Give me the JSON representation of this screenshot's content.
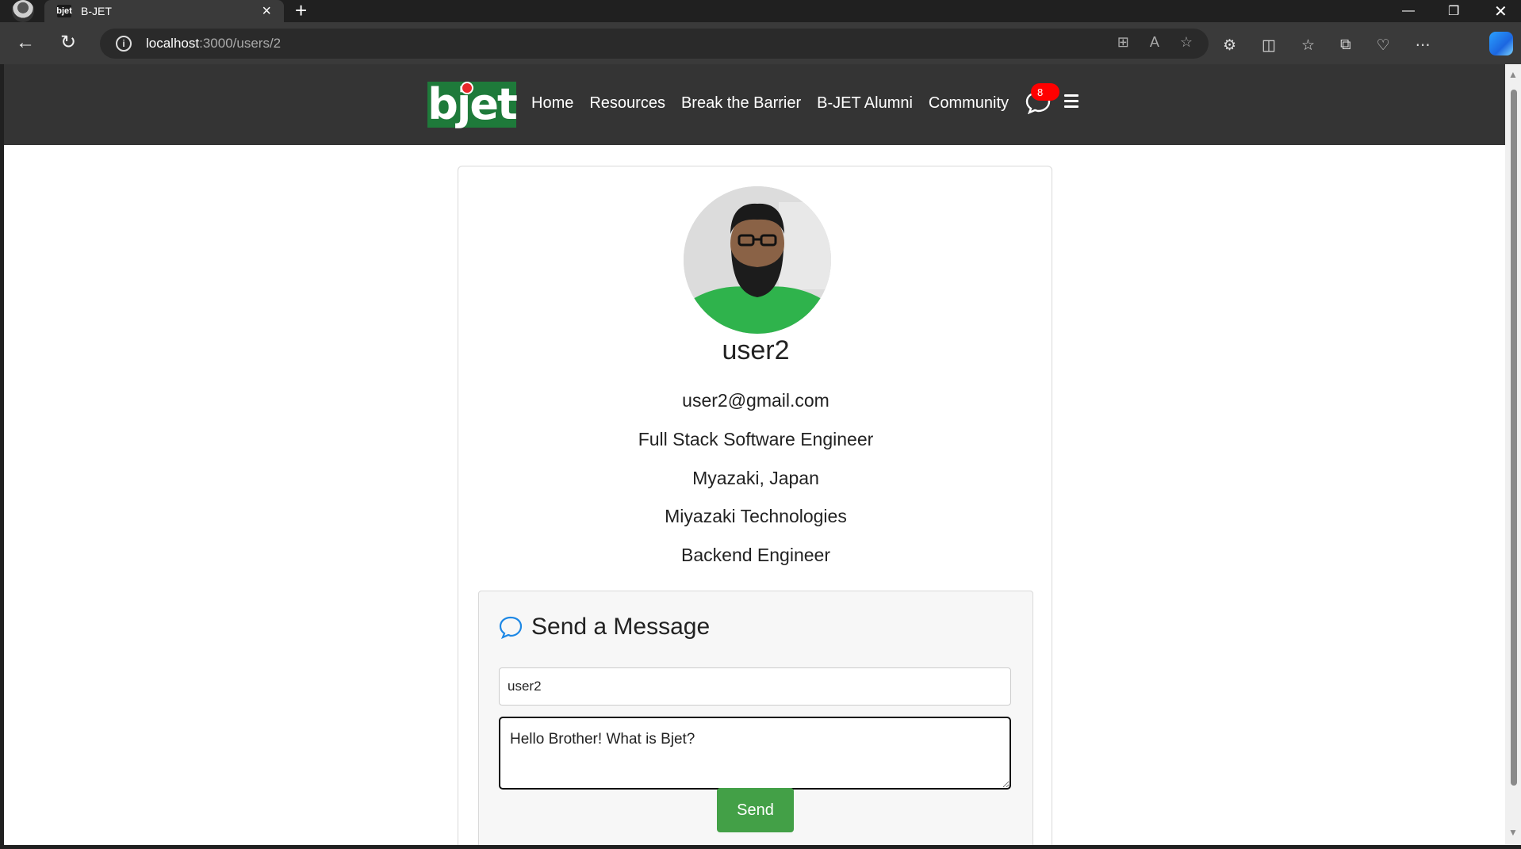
{
  "browser": {
    "tab_title": "B-JET",
    "tab_favicon_text": "bjet",
    "url_host": "localhost",
    "url_path": ":3000/users/2"
  },
  "site": {
    "logo_text": "bjet",
    "nav": [
      "Home",
      "Resources",
      "Break the Barrier",
      "B-JET Alumni",
      "Community"
    ],
    "message_badge": "8"
  },
  "profile": {
    "username": "user2",
    "email": "user2@gmail.com",
    "title": "Full Stack Software Engineer",
    "location": "Myazaki, Japan",
    "company": "Miyazaki Technologies",
    "role": "Backend Engineer"
  },
  "message_form": {
    "heading": "Send a Message",
    "recipient_value": "user2",
    "body_value": "Hello Brother! What is Bjet?",
    "send_label": "Send"
  },
  "colors": {
    "nav_bg": "#343434",
    "logo_green": "#1e7a3a",
    "send_green": "#43a047",
    "badge_red": "#ff0000"
  },
  "icons": [
    "back-icon",
    "reload-icon",
    "info-icon",
    "chat-icon",
    "hamburger-icon",
    "speech-bubble-icon"
  ]
}
